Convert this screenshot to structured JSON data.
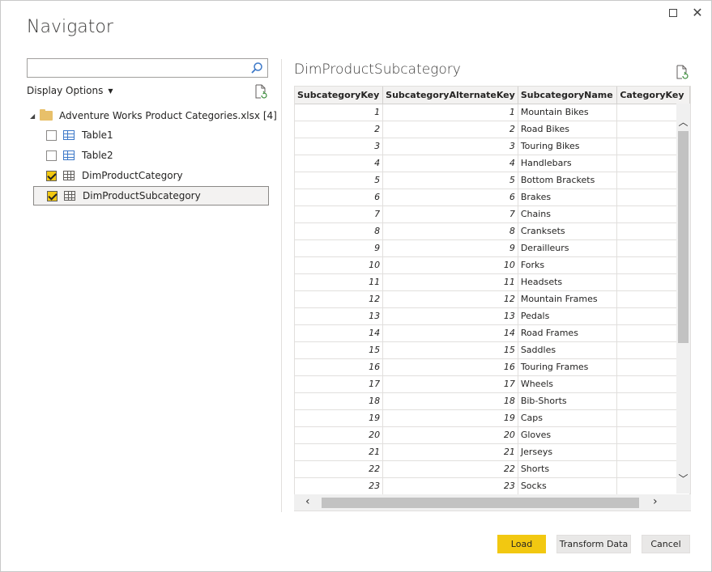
{
  "window": {
    "title": "Navigator",
    "maximize_icon": "maximize-icon",
    "close_glyph": "✕"
  },
  "left": {
    "search": {
      "value": "",
      "placeholder": ""
    },
    "display_options_label": "Display Options",
    "tree": {
      "folder_label": "Adventure Works Product Categories.xlsx [4]",
      "items": [
        {
          "label": "Table1",
          "checked": false,
          "icon": "table-icon"
        },
        {
          "label": "Table2",
          "checked": false,
          "icon": "table-icon"
        },
        {
          "label": "DimProductCategory",
          "checked": true,
          "icon": "table-icon"
        },
        {
          "label": "DimProductSubcategory",
          "checked": true,
          "icon": "table-icon",
          "selected": true
        }
      ]
    }
  },
  "preview": {
    "title": "DimProductSubcategory",
    "columns": [
      "SubcategoryKey",
      "SubcategoryAlternateKey",
      "SubcategoryName",
      "CategoryKey"
    ],
    "rows": [
      [
        "1",
        "1",
        "Mountain Bikes",
        ""
      ],
      [
        "2",
        "2",
        "Road Bikes",
        ""
      ],
      [
        "3",
        "3",
        "Touring Bikes",
        ""
      ],
      [
        "4",
        "4",
        "Handlebars",
        ""
      ],
      [
        "5",
        "5",
        "Bottom Brackets",
        ""
      ],
      [
        "6",
        "6",
        "Brakes",
        ""
      ],
      [
        "7",
        "7",
        "Chains",
        ""
      ],
      [
        "8",
        "8",
        "Cranksets",
        ""
      ],
      [
        "9",
        "9",
        "Derailleurs",
        ""
      ],
      [
        "10",
        "10",
        "Forks",
        ""
      ],
      [
        "11",
        "11",
        "Headsets",
        ""
      ],
      [
        "12",
        "12",
        "Mountain Frames",
        ""
      ],
      [
        "13",
        "13",
        "Pedals",
        ""
      ],
      [
        "14",
        "14",
        "Road Frames",
        ""
      ],
      [
        "15",
        "15",
        "Saddles",
        ""
      ],
      [
        "16",
        "16",
        "Touring Frames",
        ""
      ],
      [
        "17",
        "17",
        "Wheels",
        ""
      ],
      [
        "18",
        "18",
        "Bib-Shorts",
        ""
      ],
      [
        "19",
        "19",
        "Caps",
        ""
      ],
      [
        "20",
        "20",
        "Gloves",
        ""
      ],
      [
        "21",
        "21",
        "Jerseys",
        ""
      ],
      [
        "22",
        "22",
        "Shorts",
        ""
      ],
      [
        "23",
        "23",
        "Socks",
        ""
      ]
    ]
  },
  "footer": {
    "load_label": "Load",
    "transform_label": "Transform Data",
    "cancel_label": "Cancel"
  },
  "colors": {
    "accent": "#f2c811",
    "table_icon": "#3c78c8",
    "folder": "#e8c06a"
  }
}
